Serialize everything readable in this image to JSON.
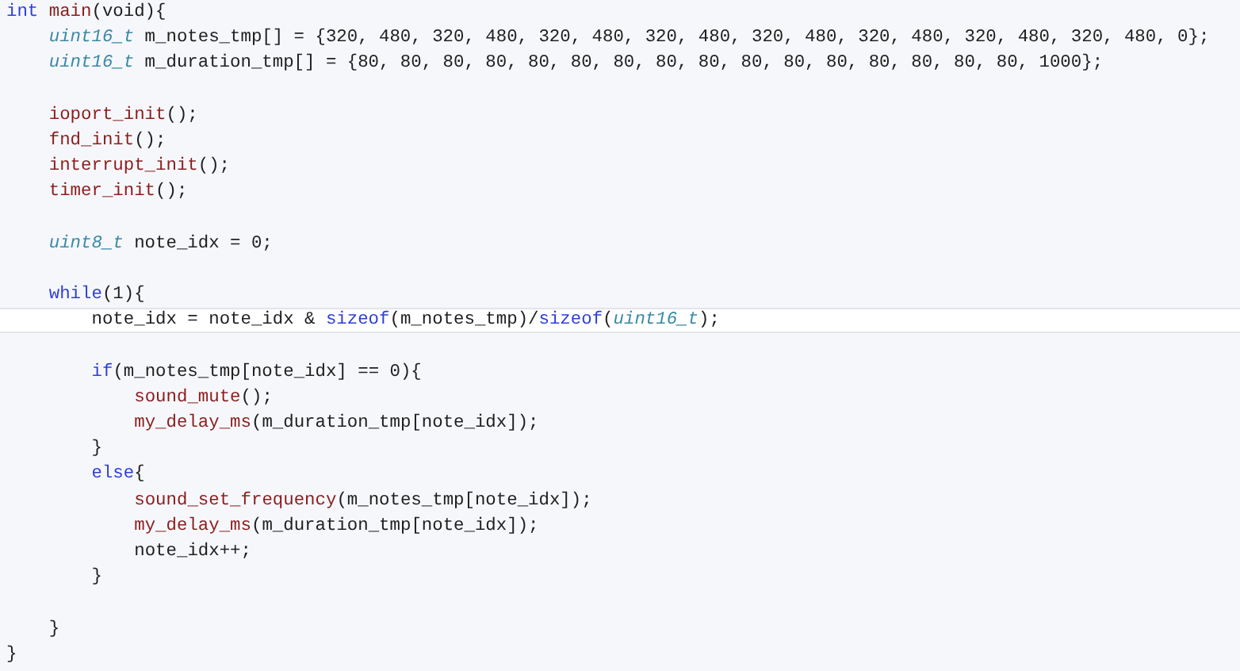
{
  "editor": {
    "lines": [
      {
        "kind": "code",
        "current": false,
        "tokens": [
          {
            "kind": "keyword",
            "text": "int"
          },
          {
            "kind": "function",
            "text": " main"
          },
          {
            "kind": "plain",
            "text": "(void){"
          }
        ],
        "children": [
          {
            "kind": "code",
            "current": false,
            "tokens": [
              {
                "kind": "type",
                "text": "uint16_t"
              },
              {
                "kind": "plain",
                "text": " m_notes_tmp[] = {320, 480, 320, 480, 320, 480, 320, 480, 320, 480, 320, 480, 320, 480, 320, 480, 0};"
              }
            ]
          },
          {
            "kind": "code",
            "current": false,
            "tokens": [
              {
                "kind": "type",
                "text": "uint16_t"
              },
              {
                "kind": "plain",
                "text": " m_duration_tmp[] = {80, 80, 80, 80, 80, 80, 80, 80, 80, 80, 80, 80, 80, 80, 80, 80, 1000};"
              }
            ]
          },
          {
            "kind": "blank",
            "current": false
          },
          {
            "kind": "code",
            "current": false,
            "tokens": [
              {
                "kind": "function",
                "text": "ioport_init"
              },
              {
                "kind": "plain",
                "text": "();"
              }
            ]
          },
          {
            "kind": "code",
            "current": false,
            "tokens": [
              {
                "kind": "function",
                "text": "fnd_init"
              },
              {
                "kind": "plain",
                "text": "();"
              }
            ]
          },
          {
            "kind": "code",
            "current": false,
            "tokens": [
              {
                "kind": "function",
                "text": "interrupt_init"
              },
              {
                "kind": "plain",
                "text": "();"
              }
            ]
          },
          {
            "kind": "code",
            "current": false,
            "tokens": [
              {
                "kind": "function",
                "text": "timer_init"
              },
              {
                "kind": "plain",
                "text": "();"
              }
            ]
          },
          {
            "kind": "blank",
            "current": false
          },
          {
            "kind": "code",
            "current": false,
            "tokens": [
              {
                "kind": "type",
                "text": "uint8_t"
              },
              {
                "kind": "plain",
                "text": " note_idx = 0;"
              }
            ]
          },
          {
            "kind": "blank",
            "current": false
          },
          {
            "kind": "code",
            "current": false,
            "tokens": [
              {
                "kind": "keyword",
                "text": "while"
              },
              {
                "kind": "plain",
                "text": "(1){"
              }
            ],
            "children": [
              {
                "kind": "code",
                "current": true,
                "tokens": [
                  {
                    "kind": "plain",
                    "text": "note_idx = note_idx & "
                  },
                  {
                    "kind": "keyword",
                    "text": "sizeof"
                  },
                  {
                    "kind": "plain",
                    "text": "(m_notes_tmp)/"
                  },
                  {
                    "kind": "keyword",
                    "text": "sizeof"
                  },
                  {
                    "kind": "plain",
                    "text": "("
                  },
                  {
                    "kind": "type",
                    "text": "uint16_t"
                  },
                  {
                    "kind": "plain",
                    "text": ");"
                  }
                ]
              },
              {
                "kind": "blank",
                "current": false
              },
              {
                "kind": "code",
                "current": false,
                "tokens": [
                  {
                    "kind": "keyword",
                    "text": "if"
                  },
                  {
                    "kind": "plain",
                    "text": "(m_notes_tmp[note_idx] == 0){"
                  }
                ],
                "children": [
                  {
                    "kind": "code",
                    "current": false,
                    "tokens": [
                      {
                        "kind": "function",
                        "text": "sound_mute"
                      },
                      {
                        "kind": "plain",
                        "text": "();"
                      }
                    ]
                  },
                  {
                    "kind": "code",
                    "current": false,
                    "tokens": [
                      {
                        "kind": "function",
                        "text": "my_delay_ms"
                      },
                      {
                        "kind": "plain",
                        "text": "(m_duration_tmp[note_idx]);"
                      }
                    ]
                  }
                ]
              },
              {
                "kind": "code",
                "current": false,
                "tokens": [
                  {
                    "kind": "plain",
                    "text": "}"
                  }
                ]
              },
              {
                "kind": "code",
                "current": false,
                "tokens": [
                  {
                    "kind": "keyword",
                    "text": "else"
                  },
                  {
                    "kind": "plain",
                    "text": "{"
                  }
                ],
                "children": [
                  {
                    "kind": "code",
                    "current": false,
                    "tokens": [
                      {
                        "kind": "function",
                        "text": "sound_set_frequency"
                      },
                      {
                        "kind": "plain",
                        "text": "(m_notes_tmp[note_idx]);"
                      }
                    ]
                  },
                  {
                    "kind": "code",
                    "current": false,
                    "tokens": [
                      {
                        "kind": "function",
                        "text": "my_delay_ms"
                      },
                      {
                        "kind": "plain",
                        "text": "(m_duration_tmp[note_idx]);"
                      }
                    ]
                  },
                  {
                    "kind": "code",
                    "current": false,
                    "tokens": [
                      {
                        "kind": "plain",
                        "text": "note_idx++;"
                      }
                    ]
                  }
                ]
              },
              {
                "kind": "code",
                "current": false,
                "tokens": [
                  {
                    "kind": "plain",
                    "text": "}"
                  }
                ]
              },
              {
                "kind": "blank",
                "current": false
              }
            ]
          },
          {
            "kind": "code",
            "current": false,
            "tokens": [
              {
                "kind": "plain",
                "text": "}"
              }
            ]
          }
        ]
      },
      {
        "kind": "code",
        "current": false,
        "tokens": [
          {
            "kind": "plain",
            "text": "}"
          }
        ]
      }
    ]
  }
}
